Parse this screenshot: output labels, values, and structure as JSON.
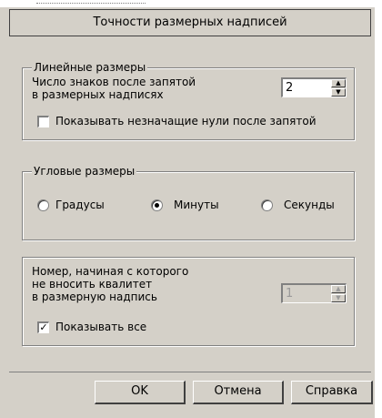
{
  "header": {
    "title": "Точности размерных надписей"
  },
  "linear": {
    "legend": "Линейные размеры",
    "decimals_label_line1": "Число знаков после запятой",
    "decimals_label_line2": "в размерных надписях",
    "decimals_value": "2",
    "show_zeros_label": "Показывать незначащие нули после запятой",
    "show_zeros_checked": false
  },
  "angular": {
    "legend": "Угловые размеры",
    "options": [
      "Градусы",
      "Минуты",
      "Секунды"
    ],
    "selected": "Минуты"
  },
  "tolerance": {
    "label_line1": "Номер, начиная с которого",
    "label_line2": "не вносить квалитет",
    "label_line3": "в размерную надпись",
    "value": "1",
    "show_all_label": "Показывать все",
    "show_all_checked": true
  },
  "buttons": {
    "ok": "OK",
    "cancel": "Отмена",
    "help": "Справка"
  }
}
